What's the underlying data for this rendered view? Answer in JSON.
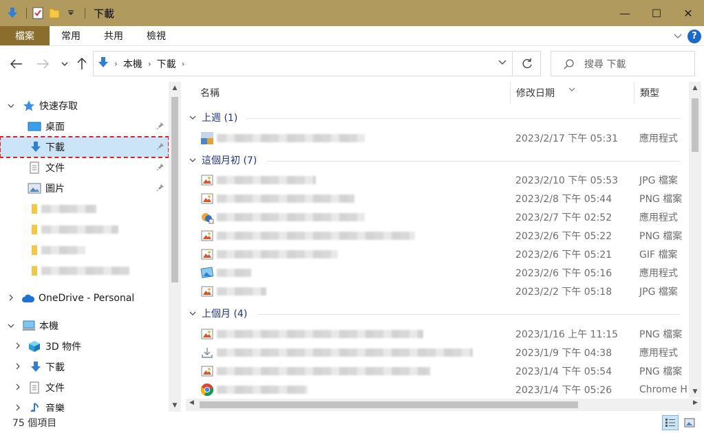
{
  "window": {
    "title": "下載",
    "controls": {
      "minimize": "—",
      "maximize": "☐",
      "close": "✕"
    }
  },
  "ribbon": {
    "tabs": [
      "檔案",
      "常用",
      "共用",
      "檢視"
    ],
    "help": "?"
  },
  "address": {
    "crumbs": [
      "本機",
      "下載"
    ],
    "search_placeholder": "搜尋 下載"
  },
  "nav": {
    "quick_access": "快速存取",
    "quick_items": [
      {
        "label": "桌面",
        "icon": "desktop-icon"
      },
      {
        "label": "下載",
        "icon": "download-arrow-icon"
      },
      {
        "label": "文件",
        "icon": "document-icon"
      },
      {
        "label": "圖片",
        "icon": "picture-icon"
      }
    ],
    "onedrive": "OneDrive - Personal",
    "this_pc": "本機",
    "pc_items": [
      {
        "label": "3D 物件",
        "icon": "3d-objects-icon"
      },
      {
        "label": "下載",
        "icon": "download-arrow-icon"
      },
      {
        "label": "文件",
        "icon": "document-icon"
      },
      {
        "label": "音樂",
        "icon": "music-icon"
      }
    ]
  },
  "columns": {
    "name": "名稱",
    "date": "修改日期",
    "type": "類型"
  },
  "groups": [
    {
      "label": "上週 (1)",
      "rows": [
        {
          "date": "2023/2/17 下午 05:31",
          "type": "應用程式",
          "icon": "app-installer-icon"
        }
      ]
    },
    {
      "label": "這個月初 (7)",
      "rows": [
        {
          "date": "2023/2/10 下午 05:53",
          "type": "JPG 檔案",
          "icon": "image-file-icon"
        },
        {
          "date": "2023/2/8 下午 05:44",
          "type": "PNG 檔案",
          "icon": "image-file-icon"
        },
        {
          "date": "2023/2/7 下午 02:52",
          "type": "應用程式",
          "icon": "setup-app-icon"
        },
        {
          "date": "2023/2/6 下午 05:22",
          "type": "PNG 檔案",
          "icon": "image-file-icon"
        },
        {
          "date": "2023/2/6 下午 05:21",
          "type": "GIF 檔案",
          "icon": "image-file-icon"
        },
        {
          "date": "2023/2/6 下午 05:16",
          "type": "應用程式",
          "icon": "photo-app-icon"
        },
        {
          "date": "2023/2/2 下午 05:18",
          "type": "JPG 檔案",
          "icon": "image-file-icon"
        }
      ]
    },
    {
      "label": "上個月 (4)",
      "rows": [
        {
          "date": "2023/1/16 上午 11:15",
          "type": "PNG 檔案",
          "icon": "image-file-icon"
        },
        {
          "date": "2023/1/9 下午 04:38",
          "type": "應用程式",
          "icon": "download-tray-icon"
        },
        {
          "date": "2023/1/4 下午 05:54",
          "type": "PNG 檔案",
          "icon": "image-file-icon"
        },
        {
          "date": "2023/1/4 下午 05:26",
          "type": "Chrome H",
          "icon": "chrome-icon"
        }
      ]
    }
  ],
  "status": {
    "count": "75 個項目"
  },
  "colors": {
    "titlebar": "#b19a5e",
    "file_tab": "#8b6d2e",
    "group_text": "#1e3287",
    "selection": "#cce4f7",
    "highlight_border": "#e02020"
  }
}
